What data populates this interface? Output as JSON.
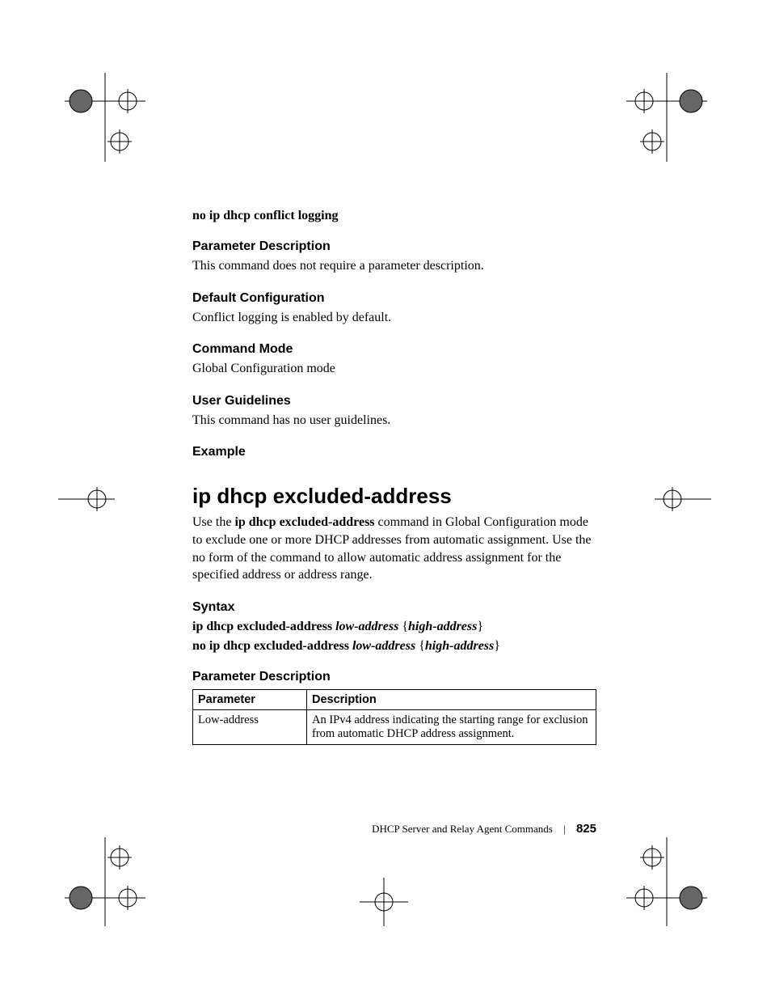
{
  "section1": {
    "no_cmd": "no ip dhcp conflict logging",
    "param_desc_h": "Parameter Description",
    "param_desc_p": "This command does not require a parameter description.",
    "default_cfg_h": "Default Configuration",
    "default_cfg_p": "Conflict logging is enabled by default.",
    "cmd_mode_h": "Command Mode",
    "cmd_mode_p": "Global Configuration mode",
    "user_guide_h": "User Guidelines",
    "user_guide_p": "This command has no user guidelines.",
    "example_h": "Example"
  },
  "section2": {
    "title": "ip dhcp excluded-address",
    "intro_pre": "Use the ",
    "intro_cmd": "ip dhcp excluded-address",
    "intro_post": " command in Global Configuration mode to exclude one or more DHCP addresses from automatic assignment. Use the no form of the command to allow automatic address assignment for the specified address or address range.",
    "syntax_h": "Syntax",
    "syntax1_cmd": "ip dhcp excluded-address ",
    "syntax1_arg1": "low-address",
    "syntax1_brace_open": " {",
    "syntax1_arg2": "high-address",
    "syntax1_brace_close": "}",
    "syntax2_cmd": "no ip dhcp excluded-address ",
    "syntax2_arg1": "low-address",
    "syntax2_brace_open": " {",
    "syntax2_arg2": "high-address",
    "syntax2_brace_close": "}",
    "param_desc_h": "Parameter Description",
    "table": {
      "h1": "Parameter",
      "h2": "Description",
      "r1c1": "Low-address",
      "r1c2": "An IPv4 address indicating the starting range for exclusion from automatic DHCP address assignment."
    }
  },
  "footer": {
    "text": "DHCP Server and Relay Agent Commands",
    "page": "825"
  }
}
